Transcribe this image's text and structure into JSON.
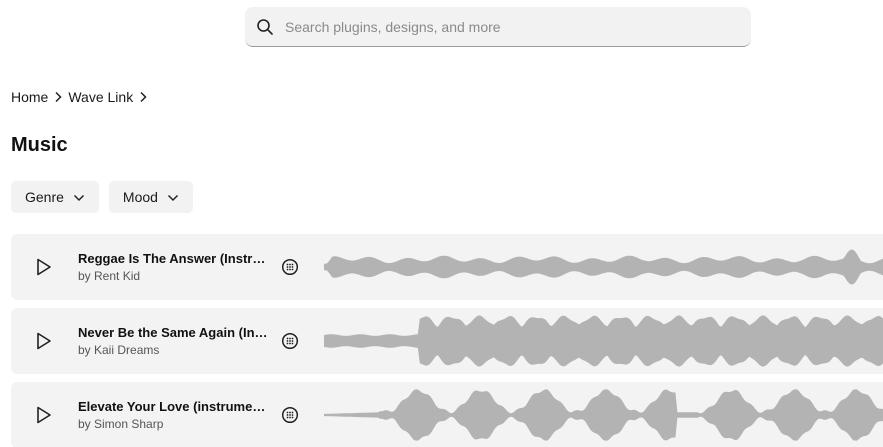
{
  "search": {
    "placeholder": "Search plugins, designs, and more",
    "icon": "search-icon"
  },
  "breadcrumb": [
    {
      "label": "Home"
    },
    {
      "label": "Wave Link"
    }
  ],
  "page_title": "Music",
  "filters": [
    {
      "label": "Genre"
    },
    {
      "label": "Mood"
    }
  ],
  "tracks": [
    {
      "title": "Reggae Is The Answer (Instrumental)",
      "artist": "by Rent Kid"
    },
    {
      "title": "Never Be the Same Again (Instrumental)",
      "artist": "by Kaii Dreams"
    },
    {
      "title": "Elevate Your Love (instrumental)",
      "artist": "by Simon Sharp"
    }
  ],
  "colors": {
    "background": "#ffffff",
    "row_background": "#f3f3f3",
    "search_background": "#f2f2f2",
    "waveform": "#b3b3b3",
    "text": "#1a1a1a",
    "muted_text": "#555555"
  }
}
